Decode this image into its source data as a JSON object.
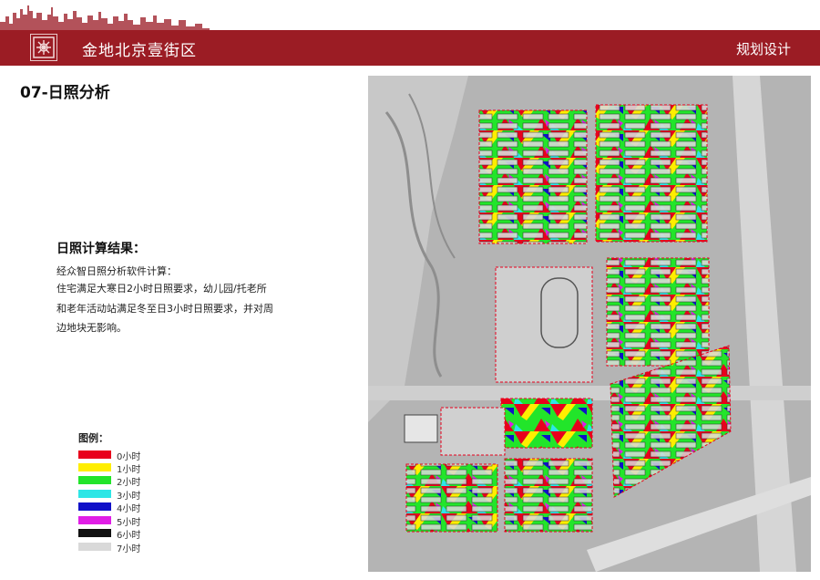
{
  "header": {
    "project_name": "金地北京壹街区",
    "section_name": "规划设计",
    "brand_color": "#9b1c24"
  },
  "page_title": "07-日照分析",
  "result": {
    "heading": "日照计算结果：",
    "lines": [
      "经众智日照分析软件计算：",
      "住宅满足大寒日2小时日照要求，幼儿园/托老所",
      "和老年活动站满足冬至日3小时日照要求，并对周",
      "边地块无影响。"
    ]
  },
  "legend": {
    "title": "图例：",
    "items": [
      {
        "label": "0小时",
        "color": "#e8001c"
      },
      {
        "label": "1小时",
        "color": "#ffee00"
      },
      {
        "label": "2小时",
        "color": "#22e52a"
      },
      {
        "label": "3小时",
        "color": "#2ee6e6"
      },
      {
        "label": "4小时",
        "color": "#1010c8"
      },
      {
        "label": "5小时",
        "color": "#e01ee6"
      },
      {
        "label": "6小时",
        "color": "#111111"
      },
      {
        "label": "7小时",
        "color": "#d9d9d9"
      }
    ]
  },
  "map": {
    "icon": "sunlight-analysis-site-plan"
  }
}
